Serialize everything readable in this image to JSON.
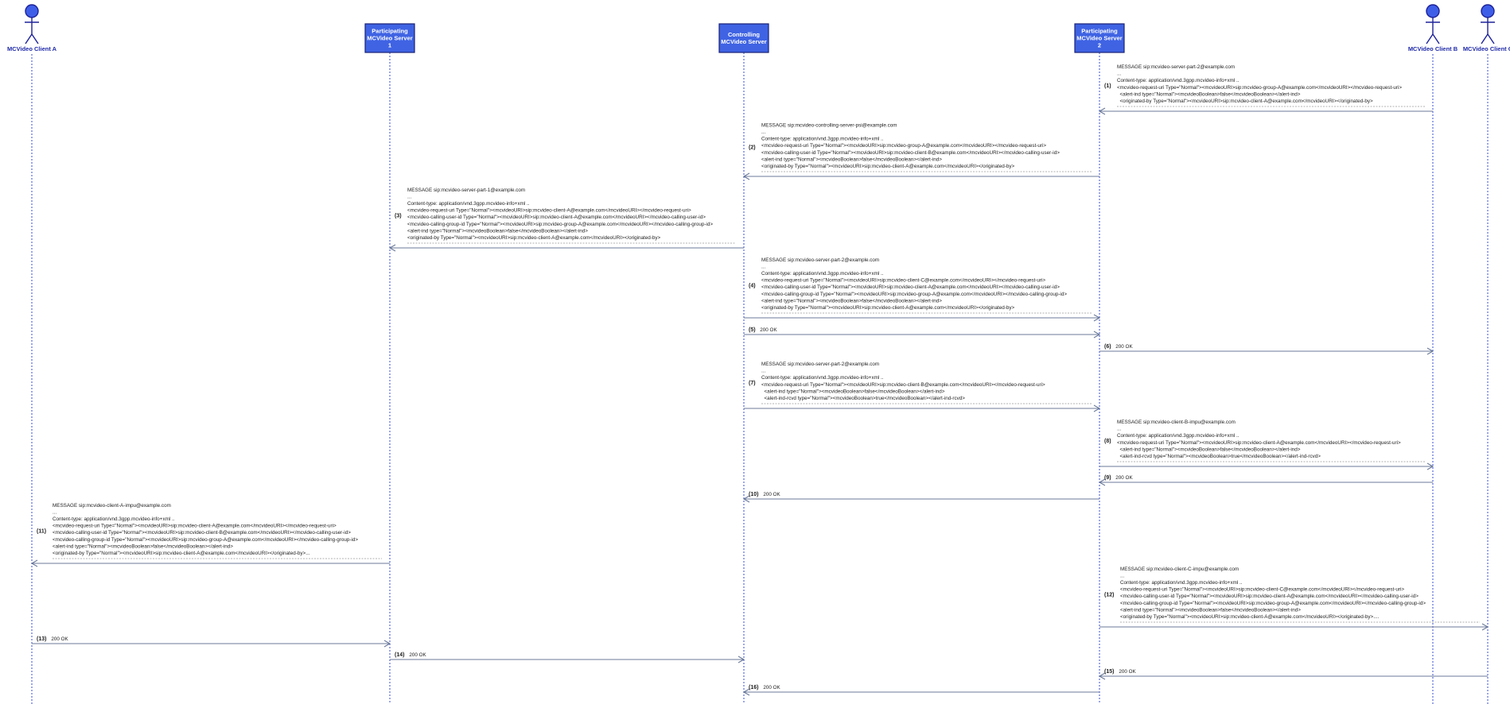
{
  "participants": [
    {
      "id": "clientA",
      "kind": "actor",
      "lines": [
        "MCVideo Client A"
      ]
    },
    {
      "id": "ps1",
      "kind": "box",
      "lines": [
        "Participating",
        "MCVideo Server",
        "1"
      ]
    },
    {
      "id": "cs",
      "kind": "box",
      "lines": [
        "Controlling",
        "MCVideo Server"
      ]
    },
    {
      "id": "ps2",
      "kind": "box",
      "lines": [
        "Participating",
        "MCVideo Server",
        "2"
      ]
    },
    {
      "id": "clientB",
      "kind": "actor",
      "lines": [
        "MCVideo Client B"
      ]
    },
    {
      "id": "clientC",
      "kind": "actor",
      "lines": [
        "MCVideo Client C"
      ]
    }
  ],
  "messages": [
    {
      "num": "(1)",
      "from": "clientB",
      "to": "ps2",
      "lines": [
        "MESSAGE sip:mcvideo-server-part-2@example.com",
        "...",
        "Content-type: application/vnd.3gpp.mcvideo-info+xml ..",
        "<mcvideo-request-uri Type=\"Normal\"><mcvideoURI>sip:mcvideo-group-A@example.com</mcvideoURI></mcvideo-request-uri>",
        "  <alert-ind type=\"Normal\"><mcvideoBoolean>false</mcvideoBoolean></alert-ind>",
        "  <originated-by Type=\"Normal\"><mcvideoURI>sip:mcvideo-client-A@example.com</mcvideoURI></originated-by>"
      ]
    },
    {
      "num": "(2)",
      "from": "ps2",
      "to": "cs",
      "lines": [
        "MESSAGE sip:mcvideo-controlling-server-psi@example.com",
        "...",
        "Content-type: application/vnd.3gpp.mcvideo-info+xml ..",
        "<mcvideo-request-uri Type=\"Normal\"><mcvideoURI>sip:mcvideo-group-A@example.com</mcvideoURI></mcvideo-request-uri>",
        "<mcvideo-calling-user-id Type=\"Normal\"><mcvideoURI>sip:mcvideo-client-B@example.com</mcvideoURI></mcvideo-calling-user-id>",
        "<alert-ind type=\"Normal\"><mcvideoBoolean>false</mcvideoBoolean></alert-ind>",
        "<originated-by Type=\"Normal\"><mcvideoURI>sip:mcvideo-client-A@example.com</mcvideoURI></originated-by>"
      ]
    },
    {
      "num": "(3)",
      "from": "cs",
      "to": "ps1",
      "lines": [
        "MESSAGE sip:mcvideo-server-part-1@example.com",
        "...",
        "Content-type: application/vnd.3gpp.mcvideo-info+xml ..",
        "<mcvideo-request-uri Type=\"Normal\"><mcvideoURI>sip:mcvideo-client-A@example.com</mcvideoURI></mcvideo-request-uri>",
        "<mcvideo-calling-user-id Type=\"Normal\"><mcvideoURI>sip:mcvideo-client-A@example.com</mcvideoURI></mcvideo-calling-user-id>",
        "<mcvideo-calling-group-id Type=\"Normal\"><mcvideoURI>sip:mcvideo-group-A@example.com</mcvideoURI></mcvideo-calling-group-id>",
        "<alert-ind type=\"Normal\"><mcvideoBoolean>false</mcvideoBoolean></alert-ind>",
        "<originated-by Type=\"Normal\"><mcvideoURI>sip:mcvideo-client-A@example.com</mcvideoURI></originated-by>"
      ]
    },
    {
      "num": "(4)",
      "from": "cs",
      "to": "ps2",
      "lines": [
        "MESSAGE sip:mcvideo-server-part-2@example.com",
        "...",
        "Content-type: application/vnd.3gpp.mcvideo-info+xml ..",
        "<mcvideo-request-uri Type=\"Normal\"><mcvideoURI>sip:mcvideo-client-C@example.com</mcvideoURI></mcvideo-request-uri>",
        "<mcvideo-calling-user-id Type=\"Normal\"><mcvideoURI>sip:mcvideo-client-A@example.com</mcvideoURI></mcvideo-calling-user-id>",
        "<mcvideo-calling-group-id Type=\"Normal\"><mcvideoURI>sip:mcvideo-group-A@example.com</mcvideoURI></mcvideo-calling-group-id>",
        "<alert-ind type=\"Normal\"><mcvideoBoolean>false</mcvideoBoolean></alert-ind>",
        "<originated-by Type=\"Normal\"><mcvideoURI>sip:mcvideo-client-A@example.com</mcvideoURI></originated-by>"
      ]
    },
    {
      "num": "(5)",
      "from": "cs",
      "to": "ps2",
      "lines": [
        "200 OK"
      ]
    },
    {
      "num": "(6)",
      "from": "ps2",
      "to": "clientB",
      "lines": [
        "200 OK"
      ]
    },
    {
      "num": "(7)",
      "from": "cs",
      "to": "ps2",
      "lines": [
        "MESSAGE sip:mcvideo-server-part-2@example.com",
        "...",
        "Content-type: application/vnd.3gpp.mcvideo-info+xml ..",
        "<mcvideo-request-uri Type=\"Normal\"><mcvideoURI>sip:mcvideo-client-B@example.com</mcvideoURI></mcvideo-request-uri>",
        "  <alert-ind type=\"Normal\"><mcvideoBoolean>false</mcvideoBoolean></alert-ind>",
        "  <alert-ind-rcvd type=\"Normal\"><mcvideoBoolean>true</mcvideoBoolean></alert-ind-rcvd>"
      ]
    },
    {
      "num": "(8)",
      "from": "ps2",
      "to": "clientB",
      "lines": [
        "MESSAGE sip:mcvideo-client-B-impu@example.com",
        "...",
        "Content-type: application/vnd.3gpp.mcvideo-info+xml ..",
        "<mcvideo-request-uri Type=\"Normal\"><mcvideoURI>sip:mcvideo-client-A@example.com</mcvideoURI></mcvideo-request-uri>",
        "  <alert-ind type=\"Normal\"><mcvideoBoolean>false</mcvideoBoolean></alert-ind>",
        "  <alert-ind-rcvd type=\"Normal\"><mcvideoBoolean>true</mcvideoBoolean></alert-ind-rcvd>"
      ]
    },
    {
      "num": "(9)",
      "from": "clientB",
      "to": "ps2",
      "lines": [
        "200 OK"
      ]
    },
    {
      "num": "(10)",
      "from": "ps2",
      "to": "cs",
      "lines": [
        "200 OK"
      ]
    },
    {
      "num": "(11)",
      "from": "ps1",
      "to": "clientA",
      "lines": [
        "MESSAGE sip:mcvideo-client-A-impu@example.com",
        "...",
        "Content-type: application/vnd.3gpp.mcvideo-info+xml ..",
        "<mcvideo-request-uri Type=\"Normal\"><mcvideoURI>sip:mcvideo-client-A@example.com</mcvideoURI></mcvideo-request-uri>",
        "<mcvideo-calling-user-id Type=\"Normal\"><mcvideoURI>sip:mcvideo-client-B@example.com</mcvideoURI></mcvideo-calling-user-id>",
        "<mcvideo-calling-group-id Type=\"Normal\"><mcvideoURI>sip:mcvideo-group-A@example.com</mcvideoURI></mcvideo-calling-group-id>",
        "<alert-ind type=\"Normal\"><mcvideoBoolean>false</mcvideoBoolean></alert-ind>",
        "<originated-by Type=\"Normal\"><mcvideoURI>sip:mcvideo-client-A@example.com</mcvideoURI></originated-by>..."
      ]
    },
    {
      "num": "(12)",
      "from": "ps2",
      "to": "clientC",
      "lines": [
        "MESSAGE sip:mcvideo-client-C-impu@example.com",
        "...",
        "Content-type: application/vnd.3gpp.mcvideo-info+xml ..",
        "<mcvideo-request-uri Type=\"Normal\"><mcvideoURI>sip:mcvideo-client-C@example.com</mcvideoURI></mcvideo-request-uri>",
        "<mcvideo-calling-user-id Type=\"Normal\"><mcvideoURI>sip:mcvideo-client-A@example.com</mcvideoURI></mcvideo-calling-user-id>",
        "<mcvideo-calling-group-id Type=\"Normal\"><mcvideoURI>sip:mcvideo-group-A@example.com</mcvideoURI></mcvideo-calling-group-id>",
        "<alert-ind type=\"Normal\"><mcvideoBoolean>false</mcvideoBoolean></alert-ind>",
        "<originated-by Type=\"Normal\"><mcvideoURI>sip:mcvideo-client-A@example.com</mcvideoURI></originated-by>...."
      ]
    },
    {
      "num": "(13)",
      "from": "clientA",
      "to": "ps1",
      "lines": [
        "200 OK"
      ]
    },
    {
      "num": "(14)",
      "from": "ps1",
      "to": "cs",
      "lines": [
        "200 OK"
      ]
    },
    {
      "num": "(15)",
      "from": "clientC",
      "to": "ps2",
      "lines": [
        "200 OK"
      ]
    },
    {
      "num": "(16)",
      "from": "ps2",
      "to": "cs",
      "lines": [
        "200 OK"
      ]
    }
  ]
}
